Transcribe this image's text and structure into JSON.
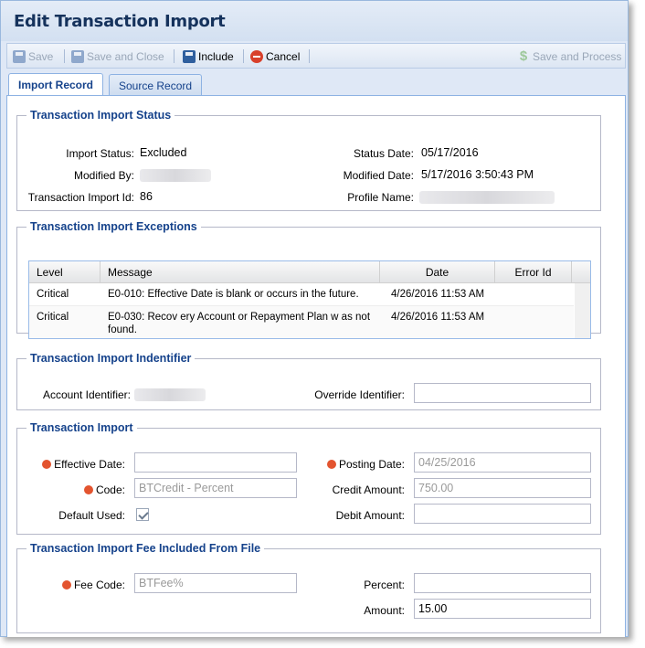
{
  "window": {
    "title": "Edit Transaction Import"
  },
  "toolbar": {
    "save": "Save",
    "save_and_close": "Save and Close",
    "include": "Include",
    "cancel": "Cancel",
    "save_and_process": "Save and Process"
  },
  "tabs": [
    {
      "label": "Import Record",
      "active": true
    },
    {
      "label": "Source Record",
      "active": false
    }
  ],
  "status": {
    "legend": "Transaction Import Status",
    "import_status_label": "Import Status:",
    "import_status_value": "Excluded",
    "modified_by_label": "Modified By:",
    "transaction_import_id_label": "Transaction Import Id:",
    "transaction_import_id_value": "86",
    "status_date_label": "Status Date:",
    "status_date_value": "05/17/2016",
    "modified_date_label": "Modified Date:",
    "modified_date_value": "5/17/2016 3:50:43 PM",
    "profile_name_label": "Profile Name:"
  },
  "exceptions": {
    "legend": "Transaction Import Exceptions",
    "columns": [
      "Level",
      "Message",
      "Date",
      "Error Id"
    ],
    "rows": [
      {
        "level": "Critical",
        "message": "E0-010: Effective Date is blank or occurs in the future.",
        "date": "4/26/2016 11:53 AM",
        "error_id": ""
      },
      {
        "level": "Critical",
        "message": "E0-030: Recov ery Account or Repayment Plan w as not found.",
        "date": "4/26/2016 11:53 AM",
        "error_id": ""
      }
    ]
  },
  "identifier": {
    "legend": "Transaction Import Indentifier",
    "account_identifier_label": "Account Identifier:",
    "override_identifier_label": "Override Identifier:",
    "override_identifier_value": ""
  },
  "transaction": {
    "legend": "Transaction Import",
    "effective_date_label": "Effective Date:",
    "effective_date_value": "",
    "code_label": "Code:",
    "code_value": "BTCredit - Percent",
    "default_used_label": "Default Used:",
    "posting_date_label": "Posting Date:",
    "posting_date_value": "04/25/2016",
    "credit_amount_label": "Credit Amount:",
    "credit_amount_value": "750.00",
    "debit_amount_label": "Debit Amount:",
    "debit_amount_value": ""
  },
  "fee": {
    "legend": "Transaction Import Fee Included From File",
    "fee_code_label": "Fee Code:",
    "fee_code_value": "BTFee%",
    "percent_label": "Percent:",
    "percent_value": "",
    "amount_label": "Amount:",
    "amount_value": "15.00"
  }
}
